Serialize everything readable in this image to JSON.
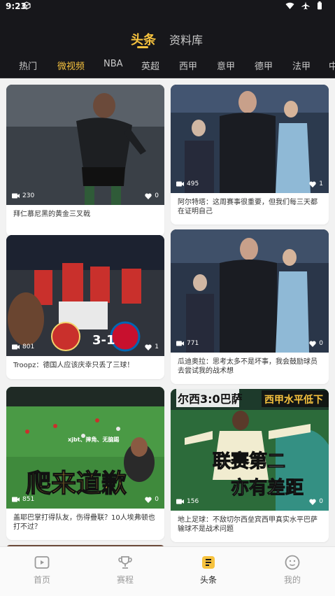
{
  "status_bar": {
    "time": "9:23"
  },
  "main_tabs": [
    {
      "label": "头条",
      "active": true
    },
    {
      "label": "资料库",
      "active": false
    }
  ],
  "sub_tabs": [
    {
      "label": "热门",
      "active": false
    },
    {
      "label": "微视频",
      "active": true
    },
    {
      "label": "NBA",
      "active": false
    },
    {
      "label": "英超",
      "active": false
    },
    {
      "label": "西甲",
      "active": false
    },
    {
      "label": "意甲",
      "active": false
    },
    {
      "label": "德甲",
      "active": false
    },
    {
      "label": "法甲",
      "active": false
    },
    {
      "label": "中",
      "active": false
    }
  ],
  "cards": [
    {
      "views": "230",
      "likes": "0",
      "title": "拜仁慕尼黑的黄金三叉戟"
    },
    {
      "views": "495",
      "likes": "1",
      "title": "阿尔特塔：这周赛事很重要，但我们每三天都在证明自己"
    },
    {
      "views": "801",
      "likes": "1",
      "title": "Troopz：德国人应该庆幸只丢了三球！",
      "badge": "3-1"
    },
    {
      "views": "771",
      "likes": "0",
      "title": "瓜迪奥拉：思考太多不是坏事，我会鼓励球员去尝试我的战术想"
    },
    {
      "views": "851",
      "likes": "0",
      "title": "盖耶巴掌打得队友，伤得疊联？10人埃弗顿也打不过？",
      "overlay": "爬来道歉",
      "sub_overlay": "xjbt、摔角、无脑踢"
    },
    {
      "views": "156",
      "likes": "0",
      "title": "地上足球：不敌切尔西垒宾西甲真实水平巴萨输球不是战术问题",
      "overlay_top_left": "尔西3:0巴萨",
      "overlay_top_right": "西甲水平低下",
      "overlay_mid": "联赛第二",
      "overlay_bottom": "亦有差距"
    }
  ],
  "bottom_nav": [
    {
      "label": "首页",
      "icon": "video-icon",
      "active": false
    },
    {
      "label": "赛程",
      "icon": "trophy-icon",
      "active": false
    },
    {
      "label": "头条",
      "icon": "news-icon",
      "active": true
    },
    {
      "label": "我的",
      "icon": "face-icon",
      "active": false
    }
  ],
  "colors": {
    "accent": "#f6c23e",
    "header_bg": "#17171b",
    "page_bg": "#f2f2f2"
  }
}
